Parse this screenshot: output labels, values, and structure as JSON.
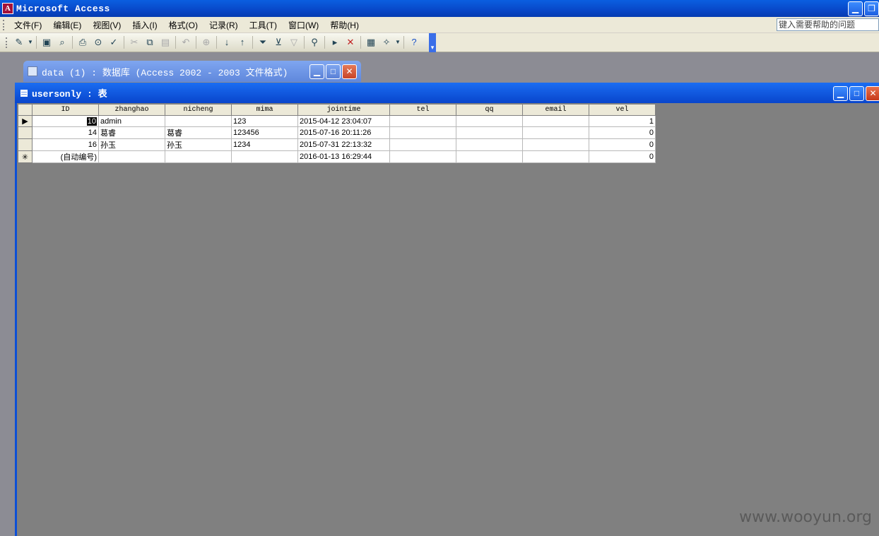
{
  "app": {
    "title": "Microsoft Access",
    "icon_letter": "A"
  },
  "menubar": {
    "items": [
      "文件(F)",
      "编辑(E)",
      "视图(V)",
      "插入(I)",
      "格式(O)",
      "记录(R)",
      "工具(T)",
      "窗口(W)",
      "帮助(H)"
    ],
    "help_placeholder": "键入需要帮助的问题"
  },
  "toolbar": {
    "icons": [
      "design-view-icon",
      "dropdown-arrow-icon",
      "save-icon",
      "search-file-icon",
      "print-icon",
      "print-preview-icon",
      "spelling-icon",
      "cut-icon",
      "copy-icon",
      "paste-icon",
      "undo-icon",
      "hyperlink-icon",
      "sort-ascending-icon",
      "sort-descending-icon",
      "filter-by-selection-icon",
      "filter-by-form-icon",
      "apply-filter-icon",
      "find-icon",
      "new-record-icon",
      "delete-record-icon",
      "database-window-icon",
      "new-object-icon",
      "help-icon"
    ]
  },
  "db_window": {
    "title": "data (1) : 数据库 (Access 2002 - 2003 文件格式)"
  },
  "table_window": {
    "title": "usersonly : 表"
  },
  "datasheet": {
    "columns": [
      "ID",
      "zhanghao",
      "nicheng",
      "mima",
      "jointime",
      "tel",
      "qq",
      "email",
      "vel"
    ],
    "rows": [
      {
        "selector": "▶",
        "ID": "10",
        "zhanghao": "admin",
        "nicheng": "",
        "mima": "123",
        "jointime": "2015-04-12 23:04:07",
        "tel": "",
        "qq": "",
        "email": "",
        "vel": "1"
      },
      {
        "selector": "",
        "ID": "14",
        "zhanghao": "葛睿",
        "nicheng": "葛睿",
        "mima": "123456",
        "jointime": "2015-07-16 20:11:26",
        "tel": "",
        "qq": "",
        "email": "",
        "vel": "0"
      },
      {
        "selector": "",
        "ID": "16",
        "zhanghao": "孙玉",
        "nicheng": "孙玉",
        "mima": "1234",
        "jointime": "2015-07-31 22:13:32",
        "tel": "",
        "qq": "",
        "email": "",
        "vel": "0"
      },
      {
        "selector": "✳",
        "ID": "(自动编号)",
        "zhanghao": "",
        "nicheng": "",
        "mima": "",
        "jointime": "2016-01-13 16:29:44",
        "tel": "",
        "qq": "",
        "email": "",
        "vel": "0"
      }
    ]
  },
  "watermark": "www.wooyun.org"
}
